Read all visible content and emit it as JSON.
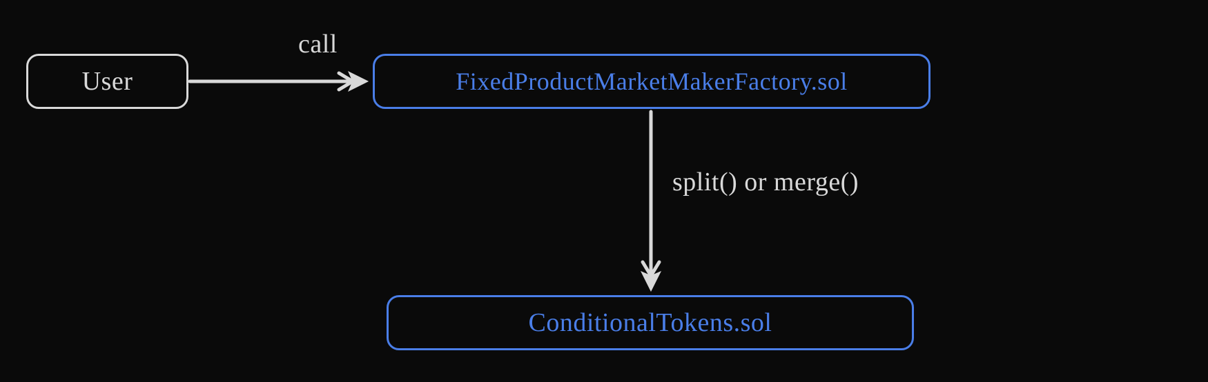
{
  "nodes": {
    "user": {
      "label": "User"
    },
    "factory": {
      "label": "FixedProductMarketMakerFactory.sol"
    },
    "conditional": {
      "label": "ConditionalTokens.sol"
    }
  },
  "edges": {
    "call": {
      "label": "call"
    },
    "split_merge": {
      "label": "split() or merge()"
    }
  },
  "colors": {
    "background": "#0a0a0a",
    "neutral": "#d9d9d9",
    "accent": "#4a7ee8"
  }
}
